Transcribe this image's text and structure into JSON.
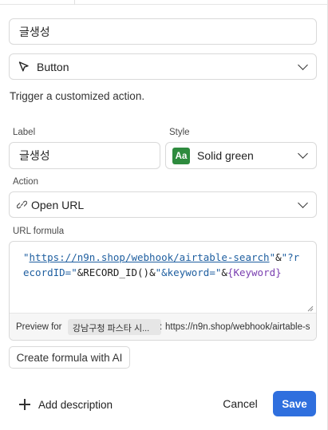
{
  "name_value": "글생성",
  "type_select": {
    "value": "Button",
    "icon": "cursor-arrow-icon"
  },
  "description": "Trigger a customized action.",
  "label_field": {
    "label": "Label",
    "value": "글생성"
  },
  "style_select": {
    "label": "Style",
    "badge": "Aa",
    "value": "Solid green",
    "badge_color": "#2e8b3e"
  },
  "action_select": {
    "label": "Action",
    "value": "Open URL",
    "icon": "link-icon"
  },
  "url_formula": {
    "label": "URL formula",
    "tokens": {
      "q1": "\"",
      "url": "https://n9n.shop/webhook/airtable-search",
      "q2": "\"",
      "amp1": "&",
      "str2": "\"?recordID=\"",
      "amp2": "&",
      "fn": "RECORD_ID()",
      "amp3": "&",
      "str3": "\"&keyword=\"",
      "amp4": "&",
      "field": "{Keyword}"
    },
    "preview_label": "Preview for",
    "preview_record": "강남구청 파스타 시...",
    "preview_sep": ":",
    "preview_url": "https://n9n.shop/webhook/airtable-s"
  },
  "ai_button": "Create formula with AI",
  "footer": {
    "add_description": "Add description",
    "cancel": "Cancel",
    "save": "Save"
  },
  "colors": {
    "accent": "#2f6fde",
    "string": "#1f5fa0",
    "field": "#7a3fb0"
  }
}
